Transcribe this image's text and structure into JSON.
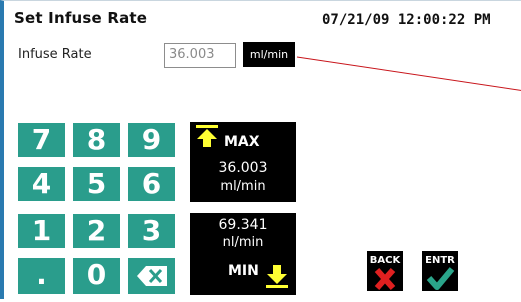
{
  "header": {
    "title": "Set Infuse Rate",
    "datetime": "07/21/09 12:00:22 PM"
  },
  "infuse_rate": {
    "label": "Infuse Rate",
    "value": "36.003",
    "unit": "ml/min"
  },
  "keypad": {
    "rows": [
      [
        "7",
        "8",
        "9"
      ],
      [
        "4",
        "5",
        "6"
      ],
      [
        "1",
        "2",
        "3"
      ],
      [
        ".",
        "0",
        "⌫"
      ]
    ]
  },
  "max_panel": {
    "label": "MAX",
    "value": "36.003",
    "unit": "ml/min",
    "arrow_icon": "arrow-up-icon",
    "arrow_color": "#ffff33"
  },
  "min_panel": {
    "label": "MIN",
    "value": "69.341",
    "unit": "nl/min",
    "arrow_icon": "arrow-down-icon",
    "arrow_color": "#ffff33"
  },
  "actions": {
    "back_label": "BACK",
    "enter_label": "ENTR",
    "back_icon": "x-icon",
    "enter_icon": "check-icon",
    "back_color": "#e02020",
    "enter_color": "#2aa58a"
  },
  "colors": {
    "key": "#2a9d8c",
    "accent_line": "#c8151b",
    "frame": "#2a7ab0"
  }
}
